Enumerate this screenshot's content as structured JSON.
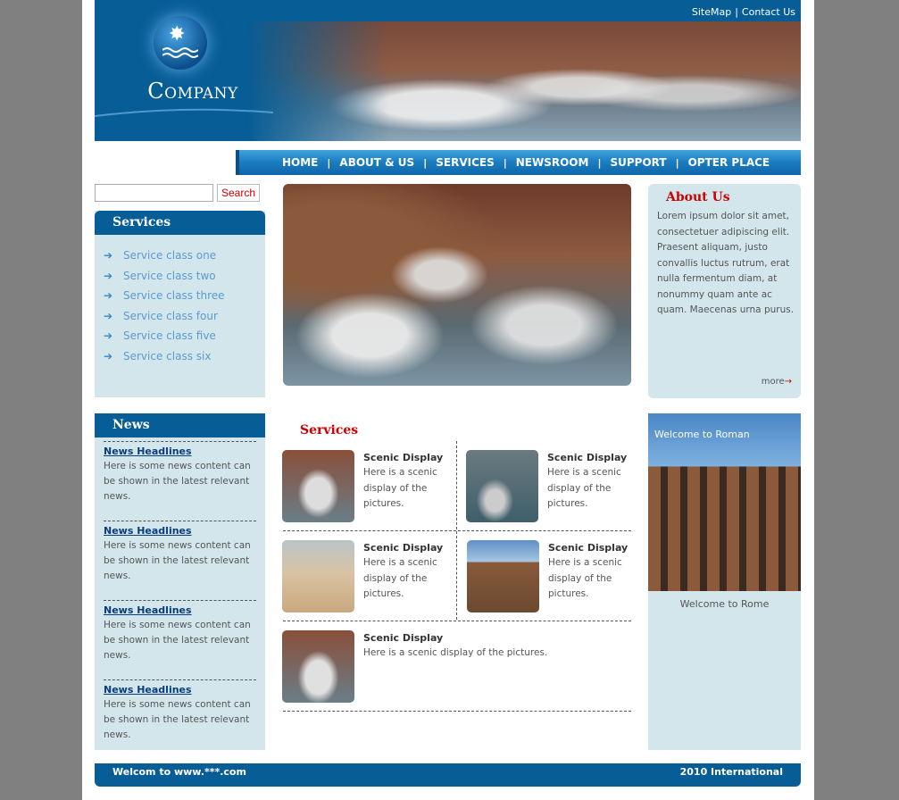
{
  "header": {
    "logo_text": "Company",
    "links": [
      "SiteMap",
      "Contact Us"
    ],
    "link_separator": "|"
  },
  "nav": {
    "items": [
      "HOME",
      "ABOUT & US",
      "SERVICES",
      "NEWSROOM",
      "SUPPORT",
      "OPTER PLACE"
    ],
    "separator": "|"
  },
  "search": {
    "placeholder": "",
    "button_label": "Search"
  },
  "services_sidebar": {
    "title": "Services",
    "items": [
      "Service class one",
      "Service class two",
      "Service class three",
      "Service class four",
      "Service class five",
      "Service class six"
    ],
    "bullet_icon": "arrow-right-icon"
  },
  "news": {
    "title": "News",
    "items": [
      {
        "title": "News Headlines",
        "body": "Here is some news content can be shown in the latest relevant news."
      },
      {
        "title": "News Headlines",
        "body": "Here is some news content can be shown in the latest relevant news."
      },
      {
        "title": "News Headlines",
        "body": "Here is some news content can be shown in the latest relevant news."
      },
      {
        "title": "News Headlines",
        "body": "Here is some news content can be shown in the latest relevant news."
      }
    ]
  },
  "about": {
    "title": "About Us",
    "text": "Lorem ipsum dolor sit amet, consectetuer adipiscing elit. Praesent aliquam, justo convallis luctus rutrum, erat nulla fermentum diam, at nonummy quam ante ac quam. Maecenas urna purus.",
    "more_label": "more"
  },
  "services_main": {
    "title": "Services",
    "cards": [
      {
        "title": "Scenic Display",
        "text": "Here is a scenic display of the pictures."
      },
      {
        "title": "Scenic Display",
        "text": "Here is a scenic display of the pictures."
      },
      {
        "title": "Scenic Display",
        "text": "Here is a scenic display of the pictures."
      },
      {
        "title": "Scenic Display",
        "text": "Here is a scenic display of the pictures."
      },
      {
        "title": "Scenic Display",
        "text": "Here is a scenic display of the pictures."
      }
    ]
  },
  "feature": {
    "overlay_text": "Welcome to Roman",
    "caption": "Welcome to Rome"
  },
  "footer": {
    "left": "Welcom to www.***.com",
    "right": "2010 International"
  },
  "colors": {
    "brand_blue": "#075d96",
    "panel_bg": "#d3e6ec",
    "accent_red": "#cc0000",
    "page_bg": "#808080"
  }
}
